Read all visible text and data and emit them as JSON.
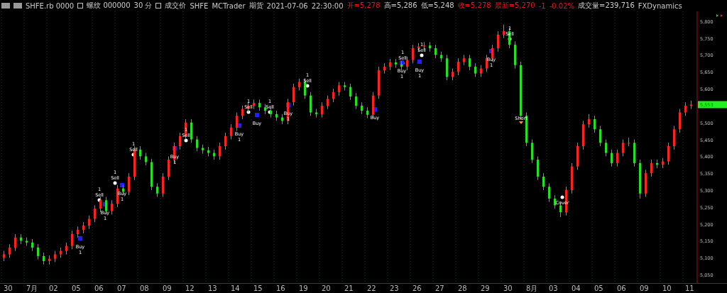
{
  "header": [
    {
      "kind": "label",
      "text": "SHFE.rb 0000"
    },
    {
      "kind": "label",
      "text": "螺纹 000000"
    },
    {
      "kind": "label",
      "text": "30 分"
    },
    {
      "kind": "label",
      "text": "成交价"
    },
    {
      "kind": "label",
      "text": "SHFE"
    },
    {
      "kind": "label",
      "text": "MCTrader"
    },
    {
      "kind": "label",
      "text": "期货"
    },
    {
      "kind": "label",
      "text": "2021-07-06"
    },
    {
      "kind": "label",
      "text": "22:30:00"
    },
    {
      "kind": "change",
      "text": "开=5,278"
    },
    {
      "kind": "label",
      "text": "高=5,286"
    },
    {
      "kind": "label",
      "text": "低=5,248"
    },
    {
      "kind": "change",
      "text": "收=5,278"
    },
    {
      "kind": "change",
      "text": "最新=5,270"
    },
    {
      "kind": "change",
      "text": "-1"
    },
    {
      "kind": "change",
      "text": "-0.02%"
    },
    {
      "kind": "label",
      "text": "成交量=239,716"
    },
    {
      "kind": "label",
      "text": "FXDynamics"
    }
  ],
  "chart": {
    "last_price": "5,553",
    "date_axis": [
      "30",
      "7月",
      "02",
      "05",
      "06",
      "07",
      "08",
      "09",
      "12",
      "13",
      "14",
      "15",
      "16",
      "19",
      "20",
      "21",
      "22",
      "23",
      "26",
      "27",
      "28",
      "29",
      "30",
      "8月",
      "03",
      "04",
      "05",
      "06",
      "09",
      "10",
      "11"
    ],
    "chart_data": {
      "type": "candlestick",
      "ylim": [
        5025,
        5829
      ],
      "yticks": [
        {
          "value": 5800,
          "label": "5,800"
        },
        {
          "value": 5750,
          "label": "5,750"
        },
        {
          "value": 5700,
          "label": "5,700"
        },
        {
          "value": 5650,
          "label": "5,650"
        },
        {
          "value": 5600,
          "label": "5,600"
        },
        {
          "value": 5500,
          "label": "5,500"
        },
        {
          "value": 5450,
          "label": "5,450"
        },
        {
          "value": 5400,
          "label": "5,400"
        },
        {
          "value": 5350,
          "label": "5,350"
        },
        {
          "value": 5300,
          "label": "5,300"
        },
        {
          "value": 5250,
          "label": "5,250"
        },
        {
          "value": 5200,
          "label": "5,200"
        },
        {
          "value": 5150,
          "label": "5,150"
        },
        {
          "value": 5100,
          "label": "5,100"
        },
        {
          "value": 5050,
          "label": "5,050"
        }
      ],
      "ohlc": [
        [
          5100,
          5120,
          5090,
          5110
        ],
        [
          5110,
          5140,
          5100,
          5130
        ],
        [
          5130,
          5170,
          5120,
          5160
        ],
        [
          5160,
          5170,
          5140,
          5150
        ],
        [
          5150,
          5160,
          5135,
          5145
        ],
        [
          5145,
          5155,
          5120,
          5130
        ],
        [
          5130,
          5140,
          5095,
          5105
        ],
        [
          5105,
          5115,
          5080,
          5090
        ],
        [
          5090,
          5107,
          5080,
          5097
        ],
        [
          5097,
          5120,
          5087,
          5110
        ],
        [
          5110,
          5130,
          5100,
          5120
        ],
        [
          5120,
          5145,
          5110,
          5135
        ],
        [
          5135,
          5180,
          5125,
          5170
        ],
        [
          5170,
          5192,
          5160,
          5182
        ],
        [
          5182,
          5205,
          5172,
          5195
        ],
        [
          5195,
          5225,
          5185,
          5215
        ],
        [
          5215,
          5255,
          5205,
          5245
        ],
        [
          5245,
          5280,
          5235,
          5270
        ],
        [
          5270,
          5280,
          5228,
          5238
        ],
        [
          5238,
          5270,
          5228,
          5260
        ],
        [
          5260,
          5315,
          5250,
          5305
        ],
        [
          5305,
          5315,
          5285,
          5295
        ],
        [
          5295,
          5350,
          5285,
          5340
        ],
        [
          5340,
          5430,
          5330,
          5420
        ],
        [
          5420,
          5430,
          5390,
          5400
        ],
        [
          5400,
          5410,
          5373,
          5383
        ],
        [
          5383,
          5393,
          5300,
          5310
        ],
        [
          5310,
          5320,
          5280,
          5290
        ],
        [
          5290,
          5350,
          5280,
          5340
        ],
        [
          5340,
          5400,
          5330,
          5390
        ],
        [
          5390,
          5440,
          5380,
          5430
        ],
        [
          5430,
          5470,
          5420,
          5460
        ],
        [
          5460,
          5510,
          5450,
          5500
        ],
        [
          5500,
          5510,
          5440,
          5450
        ],
        [
          5450,
          5460,
          5415,
          5425
        ],
        [
          5425,
          5435,
          5408,
          5418
        ],
        [
          5418,
          5428,
          5400,
          5410
        ],
        [
          5410,
          5420,
          5390,
          5400
        ],
        [
          5400,
          5440,
          5390,
          5430
        ],
        [
          5430,
          5470,
          5420,
          5460
        ],
        [
          5460,
          5495,
          5450,
          5485
        ],
        [
          5485,
          5530,
          5475,
          5520
        ],
        [
          5520,
          5550,
          5510,
          5540
        ],
        [
          5540,
          5560,
          5530,
          5550
        ],
        [
          5550,
          5568,
          5540,
          5558
        ],
        [
          5558,
          5568,
          5535,
          5545
        ],
        [
          5545,
          5555,
          5525,
          5535
        ],
        [
          5535,
          5545,
          5515,
          5525
        ],
        [
          5525,
          5535,
          5505,
          5515
        ],
        [
          5515,
          5525,
          5495,
          5505
        ],
        [
          5505,
          5570,
          5495,
          5560
        ],
        [
          5560,
          5615,
          5550,
          5605
        ],
        [
          5605,
          5630,
          5595,
          5620
        ],
        [
          5620,
          5630,
          5570,
          5580
        ],
        [
          5580,
          5590,
          5520,
          5530
        ],
        [
          5530,
          5540,
          5515,
          5525
        ],
        [
          5525,
          5560,
          5515,
          5550
        ],
        [
          5550,
          5580,
          5540,
          5570
        ],
        [
          5570,
          5600,
          5560,
          5590
        ],
        [
          5590,
          5620,
          5580,
          5610
        ],
        [
          5610,
          5620,
          5595,
          5605
        ],
        [
          5605,
          5615,
          5567,
          5577
        ],
        [
          5577,
          5587,
          5540,
          5550
        ],
        [
          5550,
          5560,
          5525,
          5535
        ],
        [
          5535,
          5545,
          5513,
          5523
        ],
        [
          5523,
          5590,
          5513,
          5580
        ],
        [
          5580,
          5665,
          5570,
          5655
        ],
        [
          5655,
          5675,
          5645,
          5665
        ],
        [
          5665,
          5688,
          5655,
          5678
        ],
        [
          5678,
          5688,
          5662,
          5672
        ],
        [
          5672,
          5682,
          5655,
          5665
        ],
        [
          5665,
          5695,
          5655,
          5685
        ],
        [
          5685,
          5730,
          5675,
          5720
        ],
        [
          5720,
          5735,
          5710,
          5725
        ],
        [
          5725,
          5738,
          5715,
          5728
        ],
        [
          5728,
          5738,
          5710,
          5720
        ],
        [
          5720,
          5730,
          5690,
          5700
        ],
        [
          5700,
          5710,
          5680,
          5690
        ],
        [
          5690,
          5700,
          5625,
          5635
        ],
        [
          5635,
          5660,
          5625,
          5650
        ],
        [
          5650,
          5690,
          5640,
          5680
        ],
        [
          5680,
          5700,
          5670,
          5690
        ],
        [
          5690,
          5700,
          5655,
          5665
        ],
        [
          5665,
          5675,
          5635,
          5645
        ],
        [
          5645,
          5670,
          5635,
          5660
        ],
        [
          5660,
          5700,
          5650,
          5690
        ],
        [
          5690,
          5730,
          5680,
          5720
        ],
        [
          5720,
          5770,
          5710,
          5760
        ],
        [
          5760,
          5790,
          5750,
          5770
        ],
        [
          5770,
          5780,
          5720,
          5730
        ],
        [
          5730,
          5740,
          5660,
          5670
        ],
        [
          5670,
          5680,
          5510,
          5520
        ],
        [
          5520,
          5530,
          5430,
          5440
        ],
        [
          5440,
          5450,
          5380,
          5390
        ],
        [
          5390,
          5400,
          5330,
          5340
        ],
        [
          5340,
          5350,
          5300,
          5310
        ],
        [
          5310,
          5320,
          5265,
          5275
        ],
        [
          5275,
          5285,
          5245,
          5255
        ],
        [
          5255,
          5265,
          5220,
          5235
        ],
        [
          5235,
          5310,
          5225,
          5300
        ],
        [
          5300,
          5380,
          5290,
          5370
        ],
        [
          5370,
          5440,
          5360,
          5430
        ],
        [
          5430,
          5505,
          5420,
          5495
        ],
        [
          5495,
          5525,
          5485,
          5510
        ],
        [
          5510,
          5520,
          5470,
          5480
        ],
        [
          5480,
          5490,
          5430,
          5440
        ],
        [
          5440,
          5450,
          5400,
          5410
        ],
        [
          5410,
          5420,
          5370,
          5380
        ],
        [
          5380,
          5420,
          5370,
          5410
        ],
        [
          5410,
          5450,
          5400,
          5440
        ],
        [
          5440,
          5455,
          5430,
          5440
        ],
        [
          5440,
          5450,
          5370,
          5380
        ],
        [
          5380,
          5390,
          5275,
          5290
        ],
        [
          5290,
          5360,
          5280,
          5350
        ],
        [
          5350,
          5390,
          5340,
          5380
        ],
        [
          5380,
          5390,
          5365,
          5375
        ],
        [
          5375,
          5395,
          5365,
          5385
        ],
        [
          5385,
          5440,
          5375,
          5430
        ],
        [
          5430,
          5490,
          5420,
          5480
        ],
        [
          5480,
          5540,
          5470,
          5530
        ],
        [
          5530,
          5560,
          5520,
          5550
        ],
        [
          5550,
          5565,
          5540,
          5553
        ]
      ]
    },
    "trades": [
      {
        "kind": "buy",
        "label": "Buy",
        "qty": "1"
      },
      {
        "kind": "sell",
        "label": "Sell",
        "qty": "1"
      },
      {
        "kind": "buy",
        "label": "Buy",
        "qty": "1"
      },
      {
        "kind": "sell",
        "label": "Sell",
        "qty": "1"
      },
      {
        "kind": "buy",
        "label": "Buy",
        "qty": "1"
      },
      {
        "kind": "sell",
        "label": "Sell",
        "qty": "1"
      },
      {
        "kind": "buy",
        "label": "Buy",
        "qty": "1"
      },
      {
        "kind": "sell",
        "label": "Sell",
        "qty": "1"
      },
      {
        "kind": "buy",
        "label": "Buy",
        "qty": "1"
      },
      {
        "kind": "sell",
        "label": "Sell",
        "qty": "1"
      },
      {
        "kind": "buy",
        "label": "Buy"
      },
      {
        "kind": "sell",
        "label": "Sell",
        "qty": "1"
      },
      {
        "kind": "buy",
        "label": "Buy",
        "qty": "1"
      },
      {
        "kind": "sell",
        "label": "Sell",
        "qty": "1"
      },
      {
        "kind": "buy",
        "label": "Buy"
      },
      {
        "kind": "sell",
        "label": "Sell",
        "qty": "1"
      },
      {
        "kind": "buy",
        "label": "Buy",
        "qty": "1"
      },
      {
        "kind": "sell",
        "label": "Sell",
        "qty": "1"
      },
      {
        "kind": "buy",
        "label": "Buy",
        "qty": "1"
      },
      {
        "kind": "buy",
        "label": "Buy",
        "qty": "1"
      },
      {
        "kind": "sell",
        "label": "Sell",
        "qty": "1"
      },
      {
        "kind": "short",
        "label": "Short"
      },
      {
        "kind": "cover",
        "label": "Cover"
      }
    ]
  }
}
